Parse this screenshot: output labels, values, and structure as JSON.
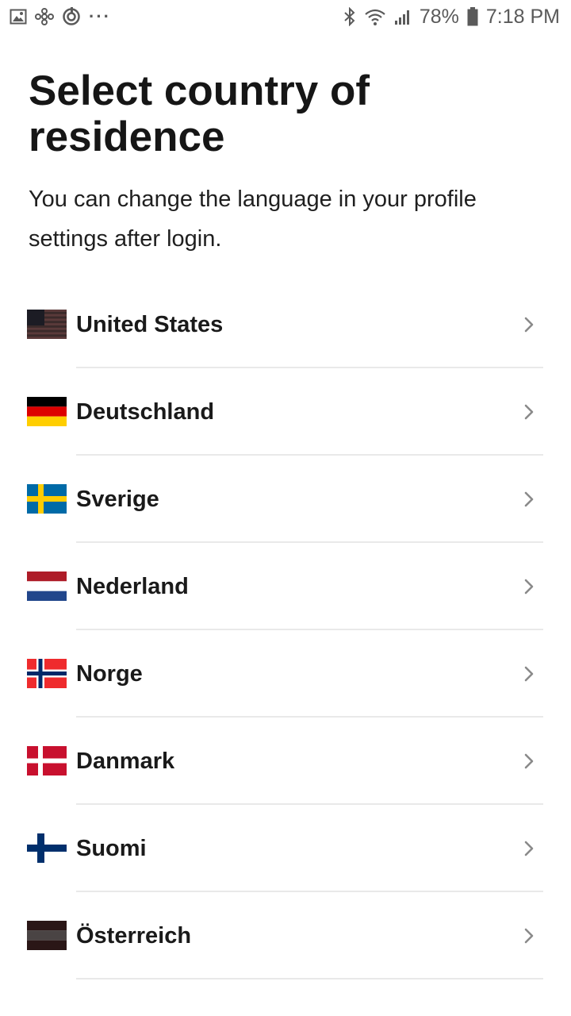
{
  "status_bar": {
    "left_icons": [
      "gallery-icon",
      "fan-icon",
      "sync-icon"
    ],
    "more": "···",
    "right_icons": [
      "bluetooth-icon",
      "wifi-icon",
      "signal-icon"
    ],
    "battery_percent": "78%",
    "battery_icon": "battery-icon",
    "time": "7:18 PM"
  },
  "title": "Select country of residence",
  "subtitle": "You can change the language in your profile settings after login.",
  "countries": [
    {
      "name": "United States",
      "flag": "us-flag-icon"
    },
    {
      "name": "Deutschland",
      "flag": "de-flag-icon"
    },
    {
      "name": "Sverige",
      "flag": "se-flag-icon"
    },
    {
      "name": "Nederland",
      "flag": "nl-flag-icon"
    },
    {
      "name": "Norge",
      "flag": "no-flag-icon"
    },
    {
      "name": "Danmark",
      "flag": "dk-flag-icon"
    },
    {
      "name": "Suomi",
      "flag": "fi-flag-icon"
    },
    {
      "name": "Österreich",
      "flag": "at-flag-icon"
    }
  ],
  "colors": {
    "text": "#1a1a1a",
    "divider": "#e9e9e9",
    "chevron": "#8a8a8a",
    "status_bar_text": "#5a5a5a"
  }
}
